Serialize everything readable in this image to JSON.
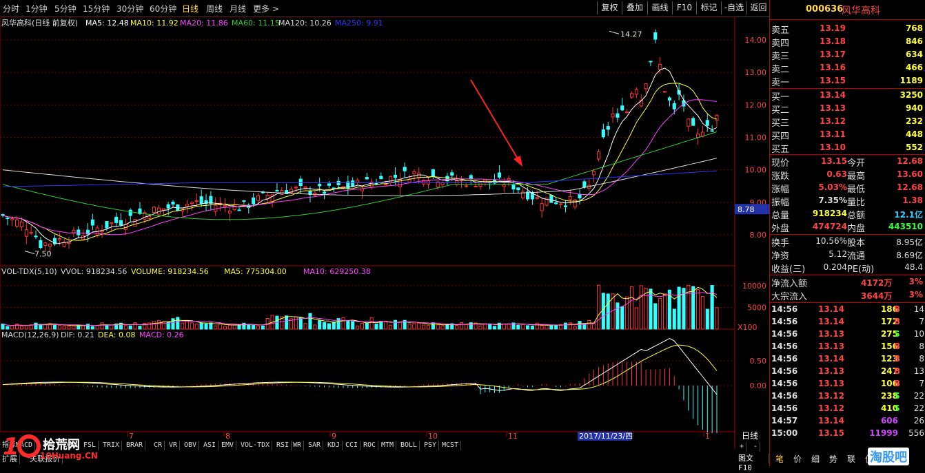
{
  "toolbar": {
    "periods": [
      "分时",
      "1分钟",
      "5分钟",
      "15分钟",
      "30分钟",
      "60分钟",
      "日线",
      "周线",
      "月线",
      "更多 >"
    ],
    "active_period": "日线",
    "buttons": [
      "复权",
      "叠加",
      "画线",
      "F10",
      "标记",
      "-自选",
      "返回"
    ]
  },
  "chart_header": {
    "title": "风华高科(日线 前复权)",
    "ma": [
      {
        "label": "MA5: 12.48",
        "color": "#ffffff"
      },
      {
        "label": "MA10: 11.92",
        "color": "#ffff33"
      },
      {
        "label": "MA20: 11.86",
        "color": "#ff44ff"
      },
      {
        "label": "MA60: 11.15",
        "color": "#33cc33"
      },
      {
        "label": "MA120: 10.26",
        "color": "#dddddd"
      },
      {
        "label": "MA250: 9.91",
        "color": "#3333ff"
      }
    ]
  },
  "price_axis": [
    "14.00",
    "13.00",
    "12.00",
    "11.00",
    "10.00",
    "9.00",
    "8.00"
  ],
  "price_tag": "8.78",
  "high_label": "14.27",
  "low_label": "7.50",
  "volume_header": {
    "name": "VOL-TDX(5,10)",
    "items": [
      {
        "label": "VVOL: 918234.56",
        "color": "#dddddd"
      },
      {
        "label": "VOLUME: 918234.56",
        "color": "#ffff33"
      },
      {
        "label": "MA5: 775304.00",
        "color": "#ffff33"
      },
      {
        "label": "MA10: 629250.38",
        "color": "#ff44ff"
      }
    ]
  },
  "volume_axis": [
    "10000",
    "5000"
  ],
  "volume_unit": "X100",
  "macd_header": {
    "name": "MACD(12,26,9)",
    "items": [
      {
        "label": "DIF: 0.21",
        "color": "#dddddd"
      },
      {
        "label": "DEA: 0.08",
        "color": "#ffff33"
      },
      {
        "label": "MACD: 0.26",
        "color": "#ff44ff"
      }
    ]
  },
  "macd_axis": [
    "0.50",
    "0.00"
  ],
  "month_labels": [
    {
      "label": "7"
    },
    {
      "label": "8"
    },
    {
      "label": "9"
    },
    {
      "label": "10"
    },
    {
      "label": "11"
    },
    {
      "label": "1"
    }
  ],
  "date_cursor": "2017/11/23/四",
  "period_box": "日线",
  "indicator_tabs": [
    "指标",
    "MACD",
    "DMI",
    "DMA",
    "FSL",
    "TRIX",
    "BRAR",
    "CR",
    "VR",
    "OBV",
    "ASI",
    "EMV",
    "VOL-TDX",
    "RSI",
    "WR",
    "SAR",
    "KDJ",
    "CCI",
    "ROC",
    "MTM",
    "BOLL",
    "PSY",
    "MCST"
  ],
  "bottom_tabs": [
    "扩展",
    "关联报价"
  ],
  "bottom_right": "图文F10",
  "watermark": {
    "main": "拾荒网",
    "sub": "10Huang.CN"
  },
  "quote": {
    "code": "000636",
    "name": "风华高科",
    "asks": [
      {
        "label": "卖五",
        "price": "13.19",
        "vol": "768"
      },
      {
        "label": "卖四",
        "price": "13.18",
        "vol": "846"
      },
      {
        "label": "卖三",
        "price": "13.17",
        "vol": "634"
      },
      {
        "label": "卖二",
        "price": "13.16",
        "vol": "466"
      },
      {
        "label": "卖一",
        "price": "13.15",
        "vol": "1189"
      }
    ],
    "bids": [
      {
        "label": "买一",
        "price": "13.14",
        "vol": "3250"
      },
      {
        "label": "买二",
        "price": "13.13",
        "vol": "940"
      },
      {
        "label": "买三",
        "price": "13.12",
        "vol": "232"
      },
      {
        "label": "买四",
        "price": "13.11",
        "vol": "448"
      },
      {
        "label": "买五",
        "price": "13.10",
        "vol": "552"
      }
    ],
    "stats": [
      [
        {
          "k": "现价",
          "v": "13.15",
          "c": "#ff4444"
        },
        {
          "k": "今开",
          "v": "12.68",
          "c": "#ff4444"
        }
      ],
      [
        {
          "k": "涨跌",
          "v": "0.63",
          "c": "#ff4444"
        },
        {
          "k": "最高",
          "v": "13.60",
          "c": "#ff4444"
        }
      ],
      [
        {
          "k": "涨幅",
          "v": "5.03%",
          "c": "#ff4444"
        },
        {
          "k": "最低",
          "v": "12.68",
          "c": "#ff4444"
        }
      ],
      [
        {
          "k": "振幅",
          "v": "7.35%",
          "c": "#dddddd"
        },
        {
          "k": "量比",
          "v": "1.38",
          "c": "#ff4444"
        }
      ],
      [
        {
          "k": "总量",
          "v": "918234",
          "c": "#ffff33"
        },
        {
          "k": "总额",
          "v": "12.1亿",
          "c": "#33ccff"
        }
      ],
      [
        {
          "k": "外盘",
          "v": "474724",
          "c": "#ff4444"
        },
        {
          "k": "内盘",
          "v": "443510",
          "c": "#33ff33"
        }
      ]
    ],
    "fundamentals": [
      [
        {
          "k": "换手",
          "v": "10.56%"
        },
        {
          "k": "股本",
          "v": "8.95亿"
        }
      ],
      [
        {
          "k": "净资",
          "v": "5.12"
        },
        {
          "k": "流通",
          "v": "8.69亿"
        }
      ],
      [
        {
          "k": "收益(三)",
          "v": "0.204"
        },
        {
          "k": "PE(动)",
          "v": "48.4"
        }
      ]
    ],
    "flows": [
      {
        "k": "净流入额",
        "v": "4172万",
        "p": "3%"
      },
      {
        "k": "大宗流入",
        "v": "3644万",
        "p": "3%"
      }
    ],
    "ticks": [
      {
        "t": "14:56",
        "p": "13.14",
        "v": "186",
        "d": "B",
        "n": "14"
      },
      {
        "t": "14:56",
        "p": "13.14",
        "v": "172",
        "d": "B",
        "n": "7"
      },
      {
        "t": "14:56",
        "p": "13.13",
        "v": "275",
        "d": "S",
        "n": "10"
      },
      {
        "t": "14:56",
        "p": "13.13",
        "v": "156",
        "d": "B",
        "n": "8"
      },
      {
        "t": "14:56",
        "p": "13.14",
        "v": "123",
        "d": "B",
        "n": "8"
      },
      {
        "t": "14:56",
        "p": "13.13",
        "v": "247",
        "d": "B",
        "n": "13"
      },
      {
        "t": "14:56",
        "p": "13.13",
        "v": "106",
        "d": "B",
        "n": "7"
      },
      {
        "t": "14:56",
        "p": "13.12",
        "v": "238",
        "d": "S",
        "n": "22"
      },
      {
        "t": "14:56",
        "p": "13.12",
        "v": "410",
        "d": "S",
        "n": "22"
      },
      {
        "t": "14:57",
        "p": "13.14",
        "v": "606",
        "d": "",
        "n": "26"
      },
      {
        "t": "15:00",
        "p": "13.15",
        "v": "11999",
        "d": "",
        "n": "556"
      }
    ],
    "tabs": [
      "笔",
      "价",
      "细",
      "势",
      "联",
      "值",
      "主",
      "筹"
    ],
    "logo": "淘股吧"
  }
}
